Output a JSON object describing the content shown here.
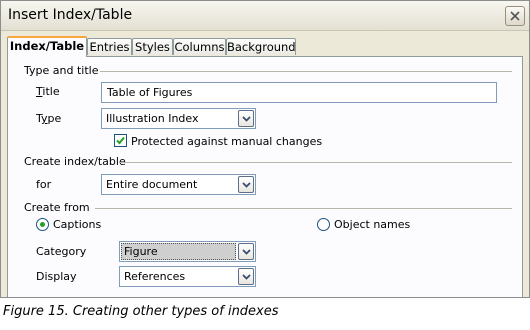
{
  "window": {
    "title": "Insert Index/Table",
    "close_icon": "close-icon"
  },
  "tabs": [
    {
      "label": "Index/Table",
      "active": true
    },
    {
      "label": "Entries",
      "active": false
    },
    {
      "label": "Styles",
      "active": false
    },
    {
      "label": "Columns",
      "active": false
    },
    {
      "label": "Background",
      "active": false
    }
  ],
  "type_and_title": {
    "heading": "Type and title",
    "title_label": "Title",
    "title_value": "Table of Figures",
    "type_label": "Type",
    "type_value": "Illustration Index",
    "protected_label": "Protected against manual changes",
    "protected_checked": true
  },
  "create_index": {
    "heading": "Create index/table",
    "for_label": "for",
    "for_value": "Entire document"
  },
  "create_from": {
    "heading": "Create from",
    "captions_label": "Captions",
    "captions_selected": true,
    "object_names_label": "Object names",
    "object_names_selected": false,
    "category_label": "Category",
    "category_value": "Figure",
    "display_label": "Display",
    "display_value": "References"
  },
  "caption": "Figure 15. Creating other types of indexes",
  "colors": {
    "dialog_bg": "#ece9d8",
    "panel_bg": "#fcfcfe",
    "tab_highlight": "#f7a73c",
    "field_border": "#7f9db9",
    "check_green": "#21a121"
  }
}
